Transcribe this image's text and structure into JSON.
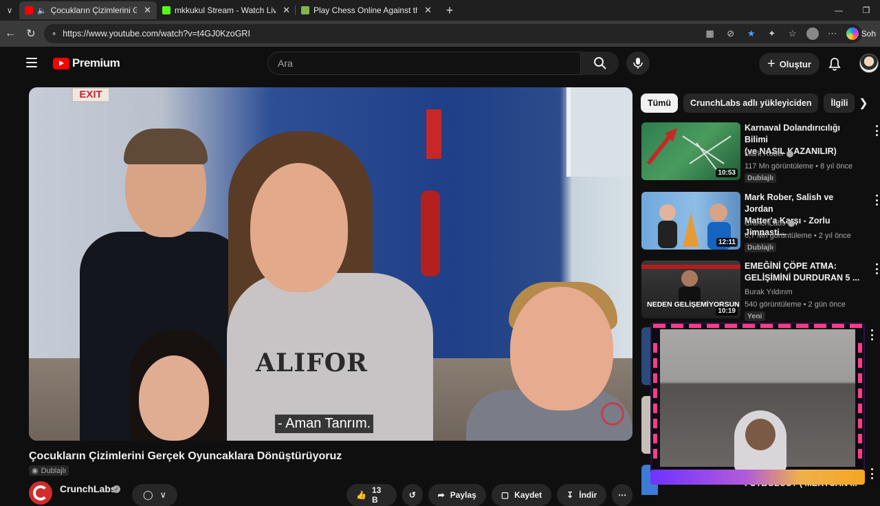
{
  "browser": {
    "tabs": [
      {
        "title": "Çocukların Çizimlerini Gerçek",
        "favicon_color": "#ff0000",
        "active": true
      },
      {
        "title": "mkkukul Stream - Watch Live on K",
        "favicon_color": "#53fc18",
        "active": false
      },
      {
        "title": "Play Chess Online Against the Con",
        "favicon_color": "#81b64c",
        "active": false
      }
    ],
    "url": "https://www.youtube.com/watch?v=t4GJ0KzoGRI",
    "copilot_label": "Soh"
  },
  "youtube": {
    "logo_text": "Premium",
    "search_placeholder": "Ara",
    "create_label": "Oluştur"
  },
  "video": {
    "subtitle": "- Aman Tanrım.",
    "scene_sign": "EXIT",
    "shirt_text": "ALIFOR",
    "title": "Çocukların Çizimlerini Gerçek Oyuncaklara Dönüştürüyoruz",
    "dub_badge": "Dublajlı",
    "channel": "CrunchLabs",
    "likes": "13 B",
    "share_label": "Paylaş",
    "save_label": "Kaydet",
    "download_label": "İndir"
  },
  "sidebar": {
    "chips": [
      "Tümü",
      "CrunchLabs adlı yükleyiciden",
      "İlgili"
    ],
    "recommendations": [
      {
        "title_line1": "Karnaval Dolandırıcılığı Bilimi",
        "title_line2": "(ve NASIL KAZANILIR)",
        "channel": "Mark Rober",
        "verified": true,
        "meta": "117 Mn görüntüleme • 8 yıl önce",
        "badge": "Dublajlı",
        "duration": "10:53",
        "thumb_colors": [
          "#2e7d4f",
          "#c62828"
        ]
      },
      {
        "title_line1": "Mark Rober, Salish ve Jordan",
        "title_line2": "Matter'a Karşı - Zorlu Jimnasti...",
        "channel": "CrunchLabs",
        "verified": true,
        "meta": "6,7 Mn görüntüleme • 2 yıl önce",
        "badge": "Dublajlı",
        "duration": "12:11",
        "thumb_colors": [
          "#6fa8dc",
          "#e69b37"
        ]
      },
      {
        "title_line1": "EMEĞİNİ ÇÖPE ATMA:",
        "title_line2": "GELİŞİMİNİ DURDURAN 5 ...",
        "channel": "Burak Yıldırım",
        "verified": false,
        "meta": "540 görüntüleme • 2 gün önce",
        "badge": "Yeni",
        "duration": "10:19",
        "thumb_text": "NEDEN GELİŞEMİYORSUN",
        "thumb_colors": [
          "#3a3a3a",
          "#b71c1c"
        ]
      }
    ],
    "partial_title": "FUTBOLCU? ( MERTCAN ..."
  },
  "colors": {
    "accent_red": "#ff0000",
    "background": "#0f0f0f",
    "overlay_purple": "#6f32ff",
    "overlay_pink": "#ff3b8a"
  }
}
